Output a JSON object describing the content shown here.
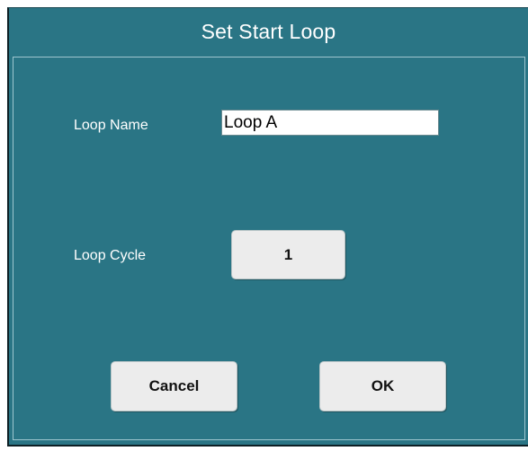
{
  "dialog": {
    "title": "Set Start Loop",
    "loop_name_label": "Loop Name",
    "loop_name_value": "Loop A",
    "loop_cycle_label": "Loop Cycle",
    "loop_cycle_value": "1",
    "cancel_label": "Cancel",
    "ok_label": "OK"
  },
  "colors": {
    "dialog_background": "#2a7585",
    "panel_border": "#9ec6cf",
    "button_background": "#ececec",
    "text_light": "#ffffff"
  }
}
